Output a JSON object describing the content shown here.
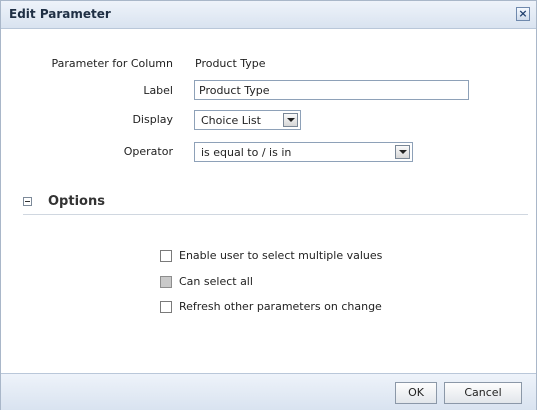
{
  "dialog": {
    "title": "Edit Parameter",
    "close_icon": "close-icon"
  },
  "form": {
    "parameter_for_column_label": "Parameter for Column",
    "parameter_for_column_value": "Product Type",
    "label_label": "Label",
    "label_value": "Product Type",
    "display_label": "Display",
    "display_value": "Choice List",
    "operator_label": "Operator",
    "operator_value": "is equal to / is in"
  },
  "options": {
    "title": "Options",
    "collapse_icon": "collapse-minus-icon",
    "checkboxes": [
      {
        "label": "Enable user to select multiple values",
        "checked": false,
        "disabled": false
      },
      {
        "label": "Can select all",
        "checked": false,
        "disabled": true
      },
      {
        "label": "Refresh other parameters on change",
        "checked": false,
        "disabled": false
      }
    ]
  },
  "footer": {
    "ok_label": "OK",
    "cancel_label": "Cancel"
  }
}
